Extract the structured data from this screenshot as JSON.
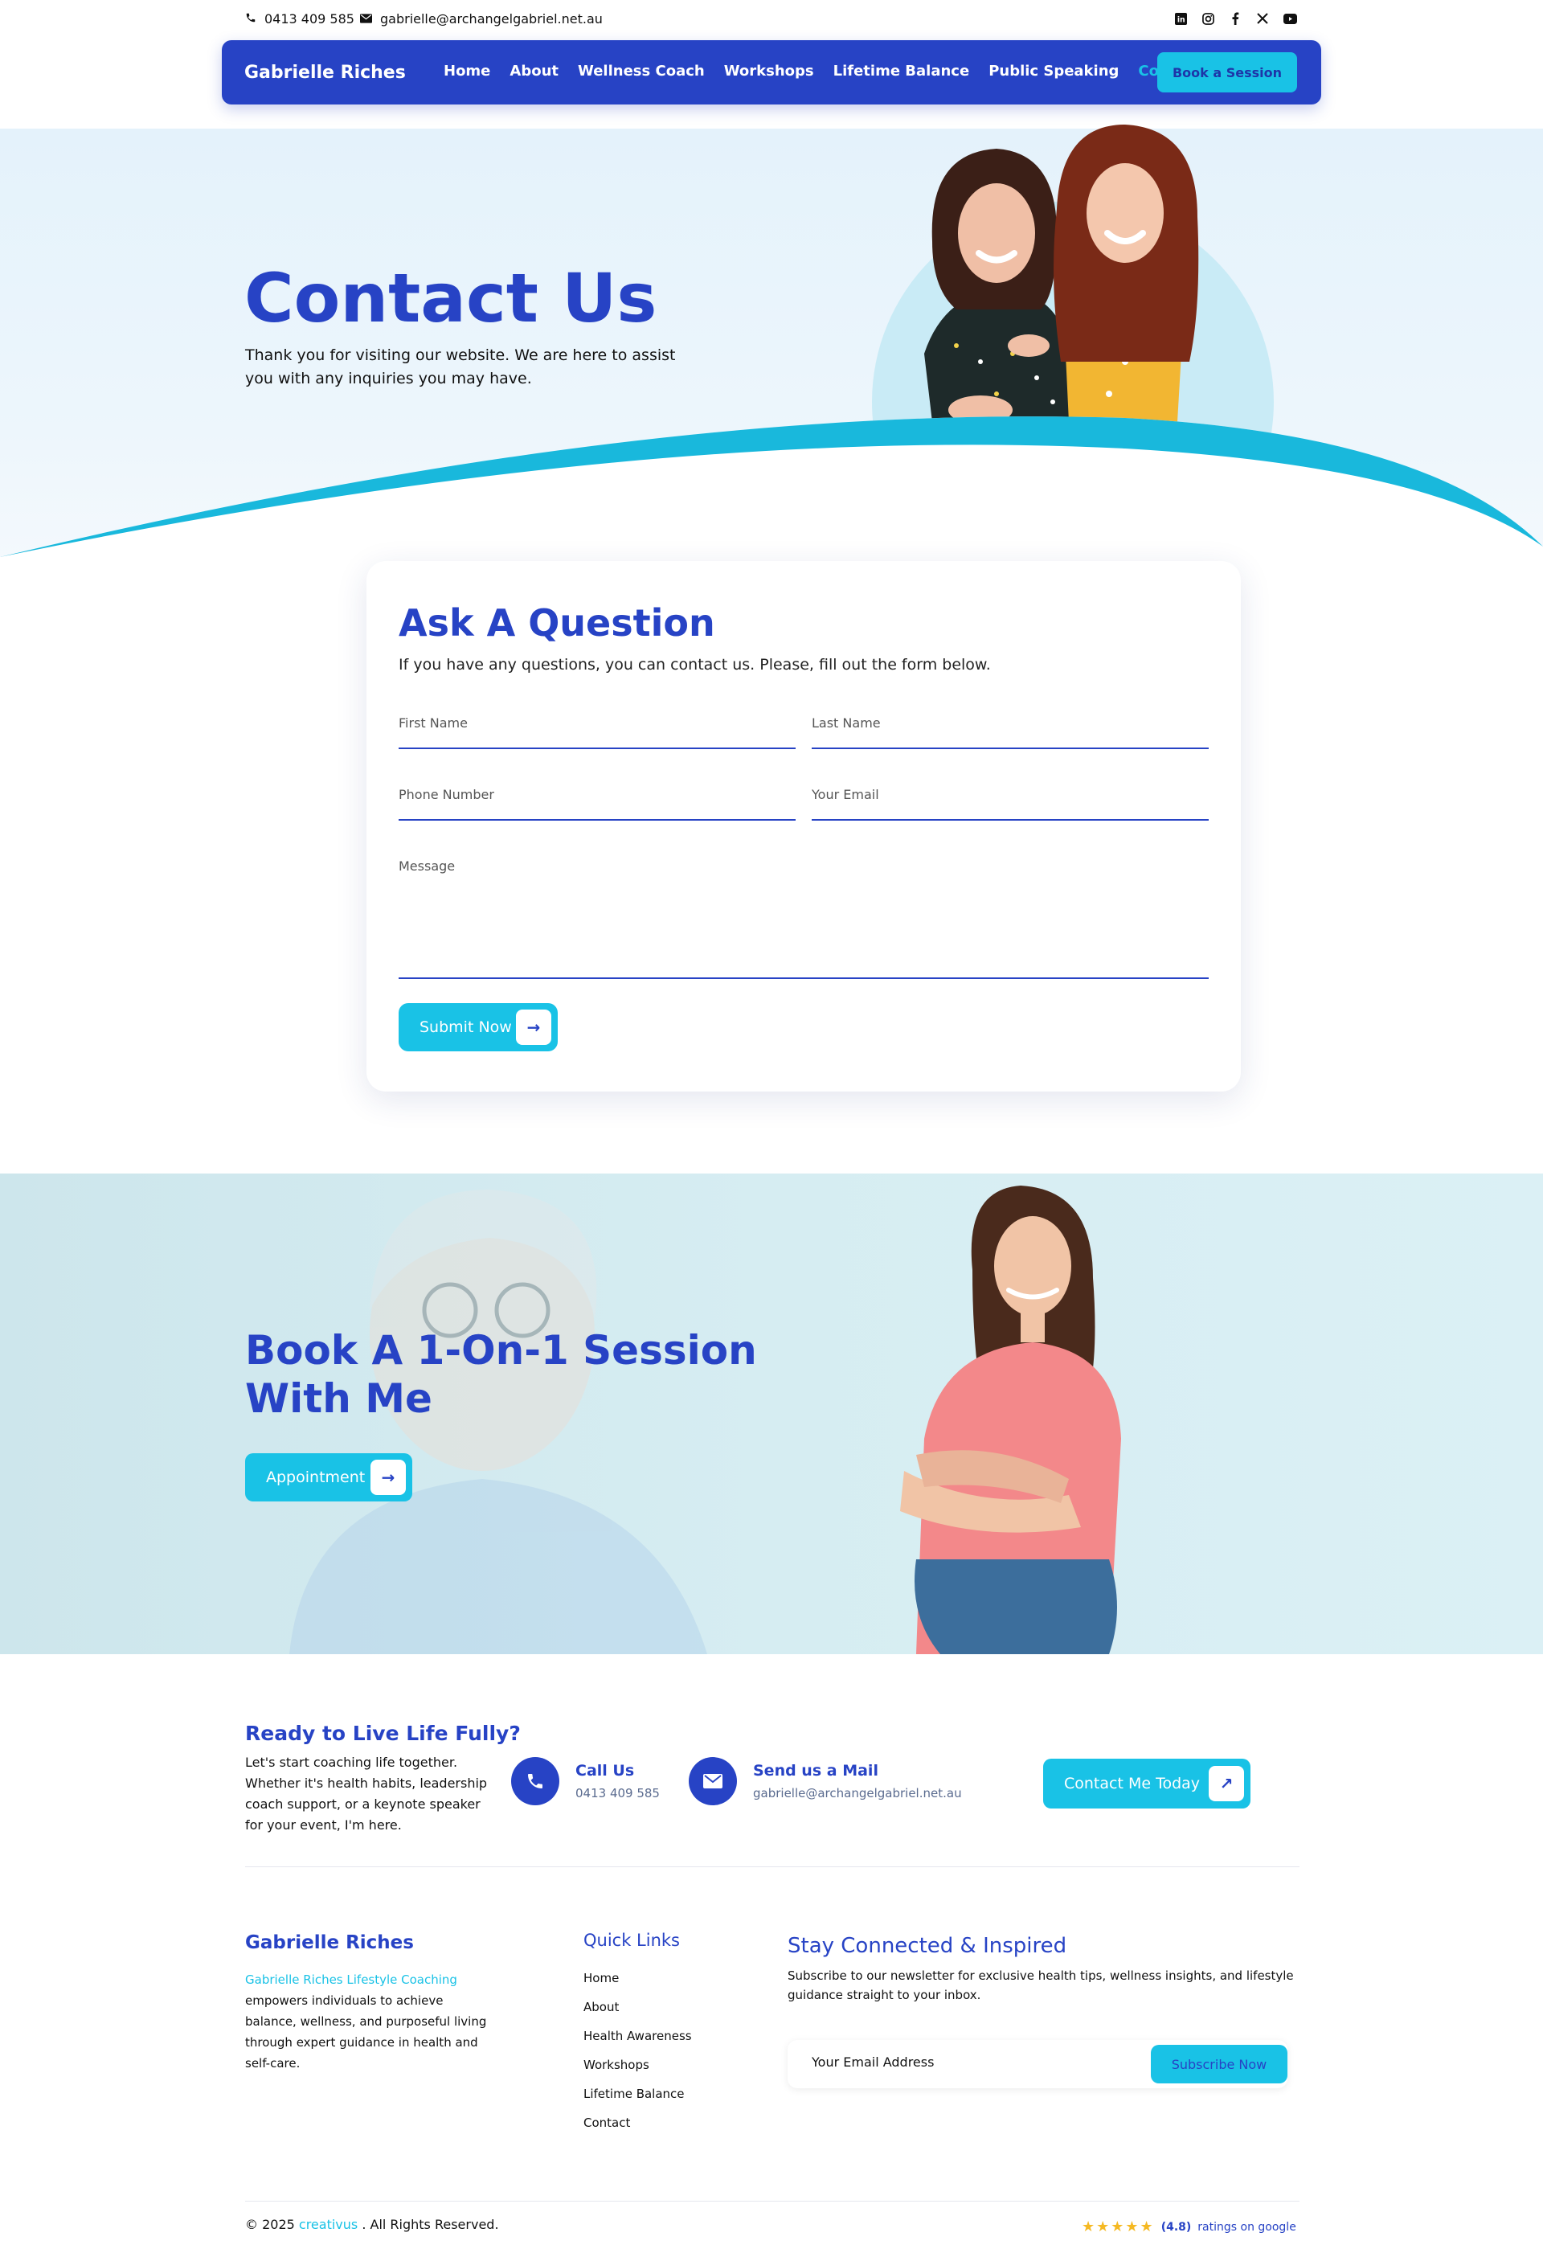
{
  "topbar": {
    "phone": "0413 409 585",
    "email": "gabrielle@archangelgabriel.net.au",
    "socials": [
      "linkedin-icon",
      "instagram-icon",
      "facebook-icon",
      "x-icon",
      "youtube-icon"
    ]
  },
  "nav": {
    "brand": "Gabrielle Riches",
    "items": [
      "Home",
      "About",
      "Wellness Coach",
      "Workshops",
      "Lifetime Balance",
      "Public Speaking",
      "Contact"
    ],
    "active": "Contact",
    "cta": "Book a Session"
  },
  "hero": {
    "title": "Contact Us",
    "text": "Thank you for visiting our website. We are here to assist you with any inquiries you may have."
  },
  "form": {
    "title": "Ask A Question",
    "subtitle": "If you have any questions, you can contact us. Please, fill out the form below.",
    "first_name_placeholder": "First Name",
    "last_name_placeholder": "Last Name",
    "phone_placeholder": "Phone Number",
    "email_placeholder": "Your Email",
    "message_placeholder": "Message",
    "submit": "Submit Now"
  },
  "booking": {
    "title_line1": "Book A 1-On-1 Session",
    "title_line2": "With Me",
    "button": "Appointment"
  },
  "cta": {
    "title": "Ready to Live Life Fully?",
    "text": "Let's start coaching life together. Whether it's health habits, leadership coach support, or a keynote speaker for your event, I'm here.",
    "call_label": "Call Us",
    "call_value": "0413 409 585",
    "mail_label": "Send us a Mail",
    "mail_value": "gabrielle@archangelgabriel.net.au",
    "button": "Contact Me Today"
  },
  "footer": {
    "brand": "Gabrielle Riches",
    "desc_highlight": "Gabrielle Riches Lifestyle Coaching",
    "desc_rest": " empowers individuals to achieve balance, wellness, and purposeful living through expert guidance in health and self-care.",
    "quick_links_title": "Quick Links",
    "quick_links": [
      "Home",
      "About",
      "Health Awareness",
      "Workshops",
      "Lifetime Balance",
      "Contact"
    ],
    "newsletter_title": "Stay Connected & Inspired",
    "newsletter_text": "Subscribe to our newsletter for exclusive health tips, wellness insights, and lifestyle guidance straight to your inbox.",
    "newsletter_placeholder": "Your Email Address",
    "subscribe": "Subscribe Now",
    "copyright_prefix": "© 2025 ",
    "copyright_brand": "creativus",
    "copyright_suffix": " . All Rights Reserved.",
    "rating_stars": "★★★★★",
    "rating_value": "(4.8)",
    "rating_text": "ratings on google"
  },
  "colors": {
    "primary": "#2743c5",
    "accent": "#19c2e6"
  }
}
